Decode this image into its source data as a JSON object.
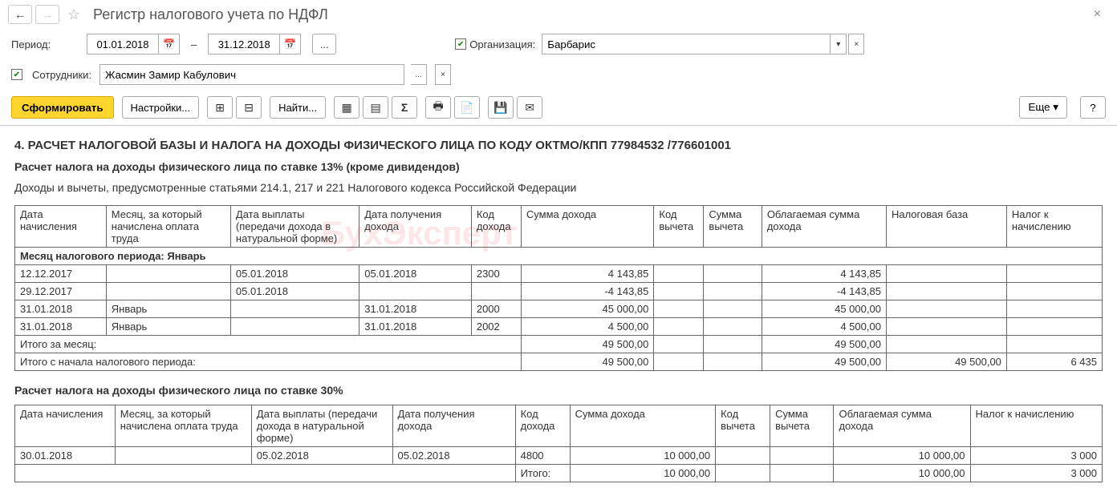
{
  "header": {
    "title": "Регистр налогового учета по НДФЛ"
  },
  "filters": {
    "period_label": "Период:",
    "date_from": "01.01.2018",
    "date_to": "31.12.2018",
    "org_label": "Организация:",
    "org_value": "Барбарис",
    "emp_label": "Сотрудники:",
    "emp_value": "Жасмин Замир Кабулович"
  },
  "actions": {
    "form": "Сформировать",
    "settings": "Настройки...",
    "find": "Найти...",
    "more": "Еще",
    "help": "?"
  },
  "report": {
    "section4_title": "4. РАСЧЕТ НАЛОГОВОЙ БАЗЫ И НАЛОГА НА ДОХОДЫ ФИЗИЧЕСКОГО ЛИЦА ПО КОДУ ОКТМО/КПП 77984532   /776601001",
    "subtitle_13": "Расчет налога на доходы физического лица по ставке 13% (кроме дивидендов)",
    "note_13": "Доходы и вычеты, предусмотренные статьями 214.1, 217 и 221 Налогового кодекса Российской Федерации",
    "cols": {
      "c1": "Дата начисления",
      "c2": "Месяц, за который начислена оплата труда",
      "c3": "Дата выплаты (передачи дохода в натуральной форме)",
      "c4": "Дата получения дохода",
      "c5": "Код дохода",
      "c6": "Сумма дохода",
      "c7": "Код вычета",
      "c8": "Сумма вычета",
      "c9": "Облагаемая сумма дохода",
      "c10": "Налоговая база",
      "c11": "Налог к начислению"
    },
    "month_label": "Месяц налогового периода: Январь",
    "rows13": [
      {
        "d": "12.12.2017",
        "m": "",
        "pay": "05.01.2018",
        "got": "05.01.2018",
        "code": "2300",
        "sum": "4 143,85",
        "vc": "",
        "vs": "",
        "tax": "4 143,85",
        "base": "",
        "ntax": ""
      },
      {
        "d": "29.12.2017",
        "m": "",
        "pay": "05.01.2018",
        "got": "",
        "code": "",
        "sum": "-4 143,85",
        "vc": "",
        "vs": "",
        "tax": "-4 143,85",
        "base": "",
        "ntax": ""
      },
      {
        "d": "31.01.2018",
        "m": "Январь",
        "pay": "",
        "got": "31.01.2018",
        "code": "2000",
        "sum": "45 000,00",
        "vc": "",
        "vs": "",
        "tax": "45 000,00",
        "base": "",
        "ntax": ""
      },
      {
        "d": "31.01.2018",
        "m": "Январь",
        "pay": "",
        "got": "31.01.2018",
        "code": "2002",
        "sum": "4 500,00",
        "vc": "",
        "vs": "",
        "tax": "4 500,00",
        "base": "",
        "ntax": ""
      }
    ],
    "total_month_label": "Итого за месяц:",
    "total_month_sum": "49 500,00",
    "total_month_tax": "49 500,00",
    "total_period_label": "Итого с начала налогового периода:",
    "total_period_sum": "49 500,00",
    "total_period_tax": "49 500,00",
    "total_period_base": "49 500,00",
    "total_period_ntax": "6 435",
    "subtitle_30": "Расчет налога на доходы физического лица по ставке 30%",
    "cols30": {
      "c1": "Дата начисления",
      "c2": "Месяц, за который начислена оплата труда",
      "c3": "Дата выплаты (передачи дохода в натуральной форме)",
      "c4": "Дата получения дохода",
      "c5": "Код дохода",
      "c6": "Сумма дохода",
      "c7": "Код вычета",
      "c8": "Сумма вычета",
      "c9": "Облагаемая сумма дохода",
      "c10": "Налог к начислению"
    },
    "row30": {
      "d": "30.01.2018",
      "m": "",
      "pay": "05.02.2018",
      "got": "05.02.2018",
      "code": "4800",
      "sum": "10 000,00",
      "vc": "",
      "vs": "",
      "tax": "10 000,00",
      "ntax": "3 000"
    },
    "total30_label": "Итого:",
    "total30_sum": "10 000,00",
    "total30_tax": "10 000,00",
    "total30_ntax": "3 000"
  },
  "watermark": "БухЭксперт"
}
